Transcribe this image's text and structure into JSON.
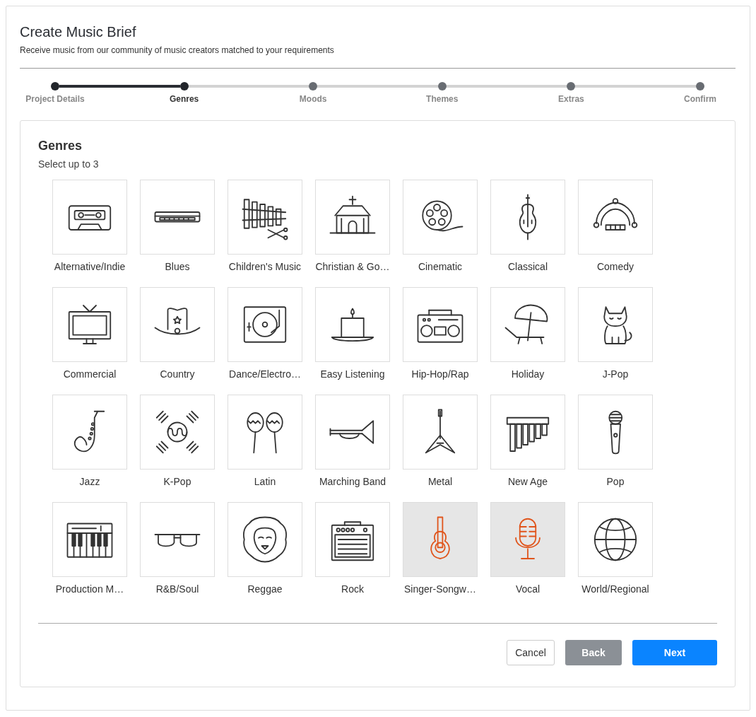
{
  "header": {
    "title": "Create Music Brief",
    "subtitle": "Receive music from our community of music creators matched to your requirements"
  },
  "steps": [
    {
      "label": "Project Details",
      "selected": false
    },
    {
      "label": "Genres",
      "selected": true
    },
    {
      "label": "Moods",
      "selected": false
    },
    {
      "label": "Themes",
      "selected": false
    },
    {
      "label": "Extras",
      "selected": false
    },
    {
      "label": "Confirm",
      "selected": false
    }
  ],
  "panel": {
    "title": "Genres",
    "hint": "Select up to 3"
  },
  "genres": [
    {
      "label": "Alternative/Indie",
      "selected": false
    },
    {
      "label": "Blues",
      "selected": false
    },
    {
      "label": "Children's Music",
      "selected": false
    },
    {
      "label": "Christian & Go…",
      "selected": false
    },
    {
      "label": "Cinematic",
      "selected": false
    },
    {
      "label": "Classical",
      "selected": false
    },
    {
      "label": "Comedy",
      "selected": false
    },
    {
      "label": "Commercial",
      "selected": false
    },
    {
      "label": "Country",
      "selected": false
    },
    {
      "label": "Dance/Electro…",
      "selected": false
    },
    {
      "label": "Easy Listening",
      "selected": false
    },
    {
      "label": "Hip-Hop/Rap",
      "selected": false
    },
    {
      "label": "Holiday",
      "selected": false
    },
    {
      "label": "J-Pop",
      "selected": false
    },
    {
      "label": "Jazz",
      "selected": false
    },
    {
      "label": "K-Pop",
      "selected": false
    },
    {
      "label": "Latin",
      "selected": false
    },
    {
      "label": "Marching Band",
      "selected": false
    },
    {
      "label": "Metal",
      "selected": false
    },
    {
      "label": "New Age",
      "selected": false
    },
    {
      "label": "Pop",
      "selected": false
    },
    {
      "label": "Production M…",
      "selected": false
    },
    {
      "label": "R&B/Soul",
      "selected": false
    },
    {
      "label": "Reggae",
      "selected": false
    },
    {
      "label": "Rock",
      "selected": false
    },
    {
      "label": "Singer-Songw…",
      "selected": true
    },
    {
      "label": "Vocal",
      "selected": true
    },
    {
      "label": "World/Regional",
      "selected": false
    }
  ],
  "buttons": [
    {
      "label": "Cancel",
      "kind": "secondary"
    },
    {
      "label": "Back",
      "kind": "muted"
    },
    {
      "label": "Next",
      "kind": "primary"
    }
  ]
}
